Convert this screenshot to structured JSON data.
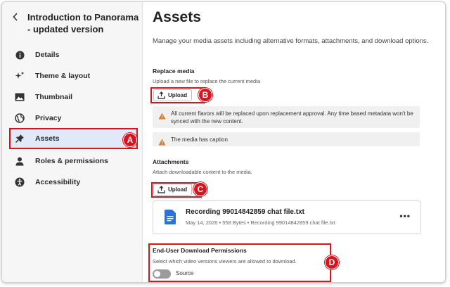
{
  "sidebar": {
    "back_icon": "chevron-left-icon",
    "title": "Introduction to Panorama - updated version",
    "items": [
      {
        "label": "Details",
        "icon": "info-icon"
      },
      {
        "label": "Theme & layout",
        "icon": "sparkle-icon"
      },
      {
        "label": "Thumbnail",
        "icon": "image-icon"
      },
      {
        "label": "Privacy",
        "icon": "globe-icon"
      },
      {
        "label": "Assets",
        "icon": "pin-icon",
        "active": true
      },
      {
        "label": "Roles & permissions",
        "icon": "person-icon"
      },
      {
        "label": "Accessibility",
        "icon": "accessibility-icon"
      }
    ]
  },
  "main": {
    "title": "Assets",
    "description": "Manage your media assets including alternative formats, attachments, and download options.",
    "replace_media": {
      "title": "Replace media",
      "subtitle": "Upload a new file to replace the current media",
      "upload_label": "Upload",
      "alerts": [
        "All current flavors will be replaced upon replacement approval. Any time based metadata won't be synced with the new content.",
        "The media has caption"
      ]
    },
    "attachments": {
      "title": "Attachments",
      "subtitle": "Attach downloadable content to the media.",
      "upload_label": "Upload",
      "file": {
        "name": "Recording 99014842859 chat file.txt",
        "meta": "May 14, 2026 • 558 Bytes • Recording 99014842859 chat file.txt"
      }
    },
    "download_permissions": {
      "title": "End-User Download Permissions",
      "subtitle": "Select which video versions viewers are allowed to download.",
      "toggle_label": "Source",
      "toggle_on": false
    }
  },
  "annotations": {
    "a": "A",
    "b": "B",
    "c": "C",
    "d": "D"
  },
  "colors": {
    "highlight": "#d9141d",
    "active_bg": "#dfe9f7",
    "doc_icon": "#2f6fd8",
    "warning": "#e07a1f"
  }
}
